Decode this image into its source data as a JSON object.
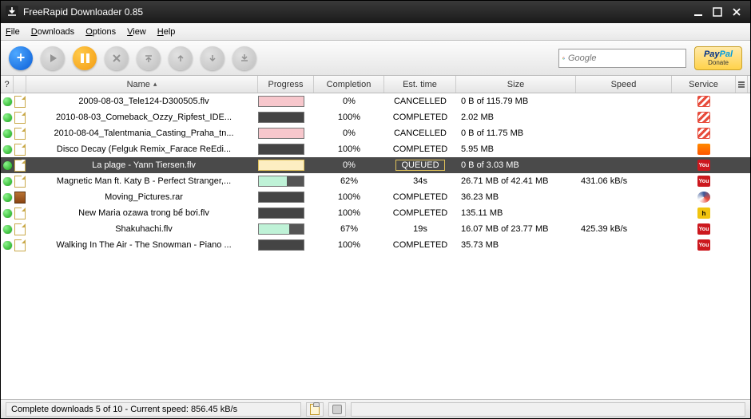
{
  "window": {
    "title": "FreeRapid Downloader 0.85"
  },
  "menu": {
    "file": "File",
    "downloads": "Downloads",
    "options": "Options",
    "view": "View",
    "help": "Help"
  },
  "search": {
    "placeholder": "Google"
  },
  "paypal": {
    "brand1": "Pay",
    "brand2": "Pal",
    "donate": "Donate"
  },
  "columns": {
    "q": "?",
    "name": "Name",
    "progress": "Progress",
    "completion": "Completion",
    "est": "Est. time",
    "size": "Size",
    "speed": "Speed",
    "service": "Service"
  },
  "rows": [
    {
      "name": "2009-08-03_Tele124-D300505.flv",
      "progStyle": "pink",
      "progPct": 100,
      "completion": "0%",
      "est": "CANCELLED",
      "size": "0 B of 115.79 MB",
      "speed": "",
      "svc": "stripes",
      "icon": "file"
    },
    {
      "name": "2010-08-03_Comeback_Ozzy_Ripfest_IDE...",
      "progStyle": "dark",
      "progPct": 100,
      "completion": "100%",
      "est": "COMPLETED",
      "size": "2.02 MB",
      "speed": "",
      "svc": "stripes",
      "icon": "file"
    },
    {
      "name": "2010-08-04_Talentmania_Casting_Praha_tn...",
      "progStyle": "pink",
      "progPct": 100,
      "completion": "0%",
      "est": "CANCELLED",
      "size": "0 B of 11.75 MB",
      "speed": "",
      "svc": "stripes",
      "icon": "file"
    },
    {
      "name": "Disco Decay (Felguk Remix_Farace ReEdi...",
      "progStyle": "dark",
      "progPct": 100,
      "completion": "100%",
      "est": "COMPLETED",
      "size": "5.95 MB",
      "speed": "",
      "svc": "sc",
      "icon": "file"
    },
    {
      "name": "La plage - Yann Tiersen.flv",
      "progStyle": "cream",
      "progPct": 100,
      "completion": "0%",
      "est": "QUEUED",
      "size": "0 B of 3.03 MB",
      "speed": "",
      "svc": "yt",
      "icon": "file",
      "selected": true
    },
    {
      "name": "Magnetic Man ft. Katy B - Perfect Stranger,...",
      "progStyle": "green",
      "progPct": 62,
      "completion": "62%",
      "est": "34s",
      "size": "26.71 MB of 42.41 MB",
      "speed": "431.06 kB/s",
      "svc": "yt",
      "icon": "file"
    },
    {
      "name": "Moving_Pictures.rar",
      "progStyle": "dark",
      "progPct": 100,
      "completion": "100%",
      "est": "COMPLETED",
      "size": "36.23 MB",
      "speed": "",
      "svc": "swirl",
      "icon": "rar"
    },
    {
      "name": "New Maria ozawa trong bể bơi.flv",
      "progStyle": "dark",
      "progPct": 100,
      "completion": "100%",
      "est": "COMPLETED",
      "size": "135.11 MB",
      "speed": "",
      "svc": "h",
      "icon": "file"
    },
    {
      "name": "Shakuhachi.flv",
      "progStyle": "green",
      "progPct": 67,
      "completion": "67%",
      "est": "19s",
      "size": "16.07 MB of 23.77 MB",
      "speed": "425.39 kB/s",
      "svc": "yt",
      "icon": "file"
    },
    {
      "name": "Walking In The Air - The Snowman - Piano ...",
      "progStyle": "dark",
      "progPct": 100,
      "completion": "100%",
      "est": "COMPLETED",
      "size": "35.73 MB",
      "speed": "",
      "svc": "yt",
      "icon": "file"
    }
  ],
  "status": {
    "text": "Complete downloads 5 of 10 - Current speed: 856.45 kB/s"
  }
}
